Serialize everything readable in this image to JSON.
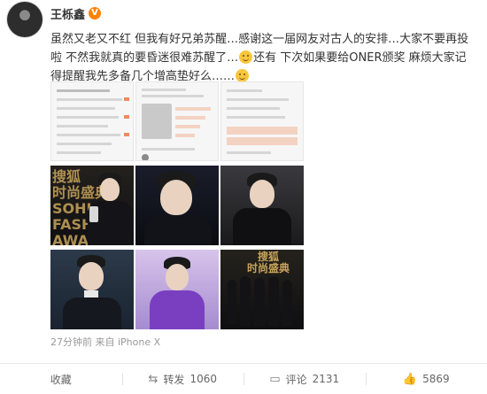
{
  "author": {
    "name": "王栎鑫",
    "verified_badge": "V"
  },
  "post": {
    "text_1": "虽然又老又不红 但我有好兄弟苏醒…感谢这一届网友对古人的安排…大家不要再投啦 不然我就真的要昏迷很难苏醒了…",
    "text_2": "还有 下次如果要给ONER颁奖 麻烦大家记得提醒我先多备几个增高垫好么……",
    "emojis": [
      "smile-icon",
      "smile-icon"
    ],
    "photo_count": 9,
    "meta": "27分钟前 来自 iPhone X"
  },
  "photos": {
    "p4_sign": "搜狐\n时尚盛典\nSOHU\nFASHION\nAWA",
    "p9_sign": "搜狐\n时尚盛典"
  },
  "actions": {
    "favorite": "收藏",
    "repost_label": "转发",
    "repost_count": "1060",
    "comment_label": "评论",
    "comment_count": "2131",
    "like_count": "5869"
  },
  "colors": {
    "vip_badge": "#ff8200",
    "text": "#333333",
    "meta": "#999999"
  }
}
